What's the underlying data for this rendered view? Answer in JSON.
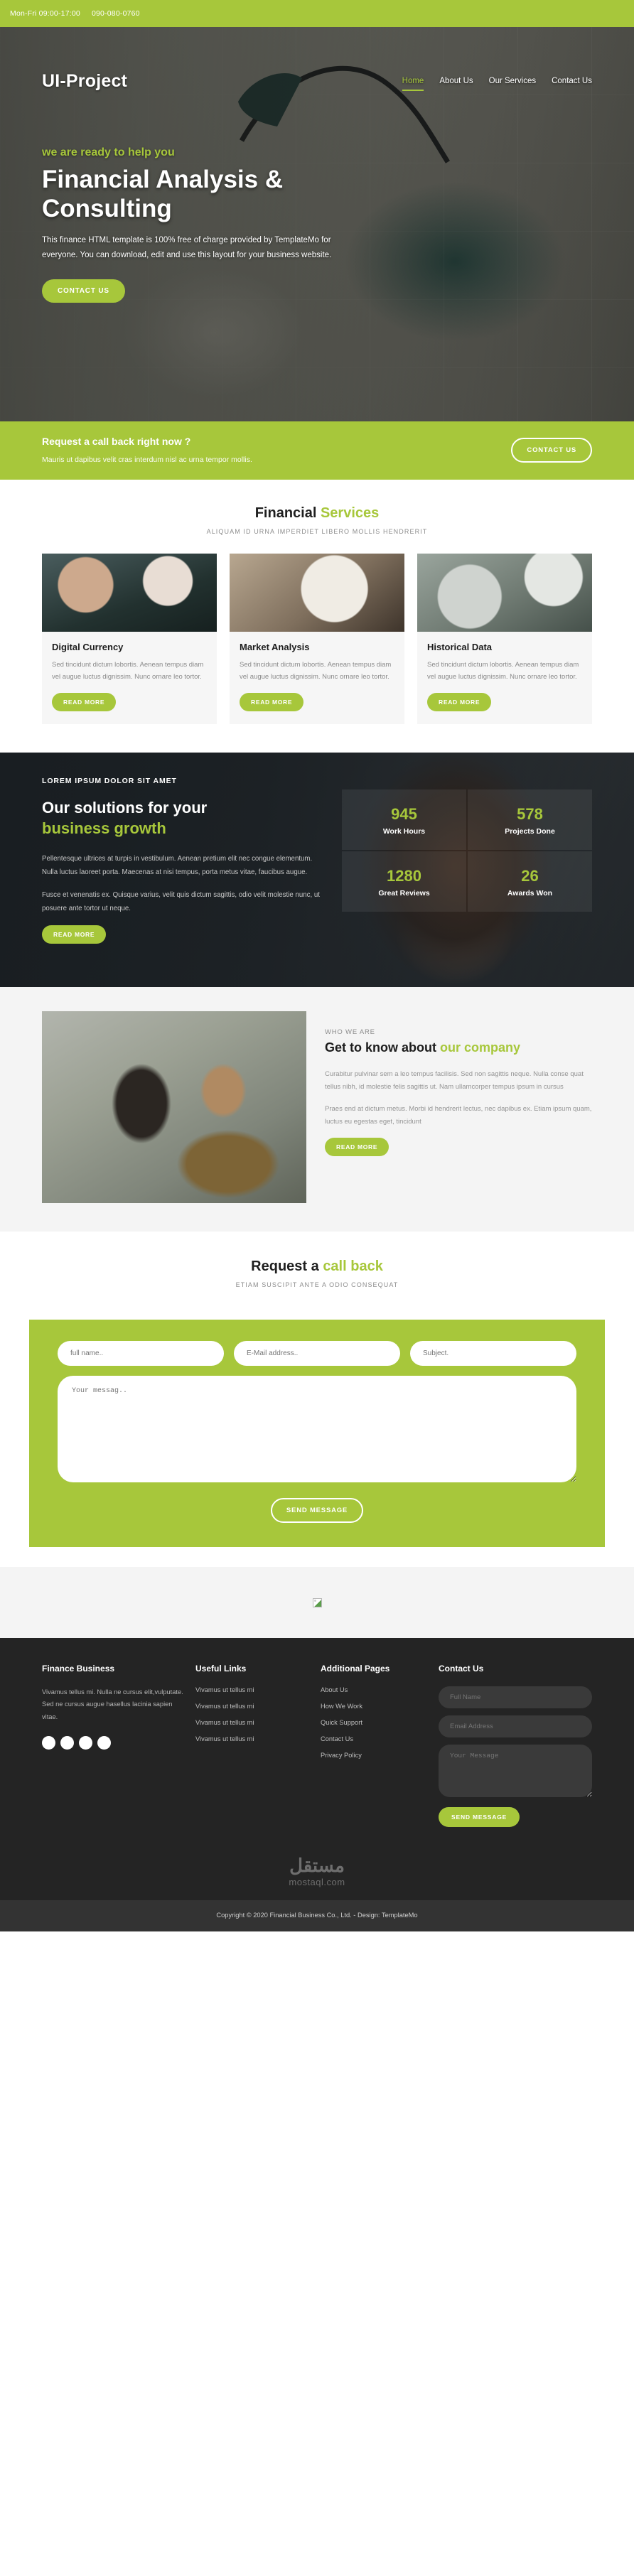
{
  "topbar": {
    "hours": "Mon-Fri 09:00-17:00",
    "phone": "090-080-0760"
  },
  "header": {
    "brand": "UI-Project",
    "nav": [
      {
        "label": "Home",
        "active": true
      },
      {
        "label": "About Us",
        "active": false
      },
      {
        "label": "Our Services",
        "active": false
      },
      {
        "label": "Contact Us",
        "active": false
      }
    ]
  },
  "hero": {
    "kicker": "we are ready to help you",
    "title": "Financial Analysis & Consulting",
    "text": "This finance HTML template is 100% free of charge provided by TemplateMo for everyone. You can download, edit and use this layout for your business website.",
    "cta": "CONTACT US"
  },
  "callback": {
    "title": "Request a call back right now ?",
    "text": "Mauris ut dapibus velit cras interdum nisl ac urna tempor mollis.",
    "cta": "CONTACT US"
  },
  "services_section": {
    "title_plain": "Financial ",
    "title_accent": "Services",
    "subtitle": "ALIQUAM ID URNA IMPERDIET LIBERO MOLLIS HENDRERIT",
    "cards": [
      {
        "title": "Digital Currency",
        "text": "Sed tincidunt dictum lobortis. Aenean tempus diam vel augue luctus dignissim. Nunc ornare leo tortor.",
        "cta": "READ MORE"
      },
      {
        "title": "Market Analysis",
        "text": "Sed tincidunt dictum lobortis. Aenean tempus diam vel augue luctus dignissim. Nunc ornare leo tortor.",
        "cta": "READ MORE"
      },
      {
        "title": "Historical Data",
        "text": "Sed tincidunt dictum lobortis. Aenean tempus diam vel augue luctus dignissim. Nunc ornare leo tortor.",
        "cta": "READ MORE"
      }
    ]
  },
  "solutions": {
    "kicker": "LOREM IPSUM DOLOR SIT AMET",
    "title_plain": "Our solutions for your",
    "title_accent": "business growth",
    "para1": "Pellentesque ultrices at turpis in vestibulum. Aenean pretium elit nec congue elementum. Nulla luctus laoreet porta. Maecenas at nisi tempus, porta metus vitae, faucibus augue.",
    "para2": "Fusce et venenatis ex. Quisque varius, velit quis dictum sagittis, odio velit molestie nunc, ut posuere ante tortor ut neque.",
    "cta": "READ MORE",
    "stats": [
      {
        "num": "945",
        "label": "Work Hours"
      },
      {
        "num": "578",
        "label": "Projects Done"
      },
      {
        "num": "1280",
        "label": "Great Reviews"
      },
      {
        "num": "26",
        "label": "Awards Won"
      }
    ]
  },
  "about": {
    "kicker": "WHO WE ARE",
    "title_plain": "Get to know about ",
    "title_accent": "our company",
    "para1": "Curabitur pulvinar sem a leo tempus facilisis. Sed non sagittis neque. Nulla conse quat tellus nibh, id molestie felis sagittis ut. Nam ullamcorper tempus ipsum in cursus",
    "para2": "Praes end at dictum metus. Morbi id hendrerit lectus, nec dapibus ex. Etiam ipsum quam, luctus eu egestas eget, tincidunt",
    "cta": "READ MORE"
  },
  "request": {
    "title_plain": "Request a ",
    "title_accent": "call back",
    "subtitle": "ETIAM SUSCIPIT ANTE A ODIO CONSEQUAT",
    "name_placeholder": "full name..",
    "email_placeholder": "E-Mail address..",
    "subject_placeholder": "Subject.",
    "message_placeholder": "Your messag..",
    "submit": "SEND MESSAGE"
  },
  "footer": {
    "col1": {
      "title": "Finance Business",
      "text": "Vivamus tellus mi. Nulla ne cursus elit,vulputate. Sed ne cursus augue hasellus lacinia sapien vitae.",
      "socials": [
        "facebook-icon",
        "twitter-icon",
        "linkedin-icon",
        "behance-icon"
      ]
    },
    "col2": {
      "title": "Useful Links",
      "links": [
        "Vivamus ut tellus mi",
        "Vivamus ut tellus mi",
        "Vivamus ut tellus mi",
        "Vivamus ut tellus mi"
      ]
    },
    "col3": {
      "title": "Additional Pages",
      "links": [
        "About Us",
        "How We Work",
        "Quick Support",
        "Contact Us",
        "Privacy Policy"
      ]
    },
    "col4": {
      "title": "Contact Us",
      "name_placeholder": "Full Name",
      "email_placeholder": "Email Address",
      "message_placeholder": "Your Message",
      "submit": "SEND MESSAGE"
    }
  },
  "watermark": {
    "arabic": "مستقل",
    "latin": "mostaql.com"
  },
  "copyright": "Copyright © 2020 Financial Business Co., Ltd. - Design: TemplateMo",
  "colors": {
    "accent": "#a7c73b",
    "dark": "#242424",
    "copyright_bg": "#333333"
  }
}
